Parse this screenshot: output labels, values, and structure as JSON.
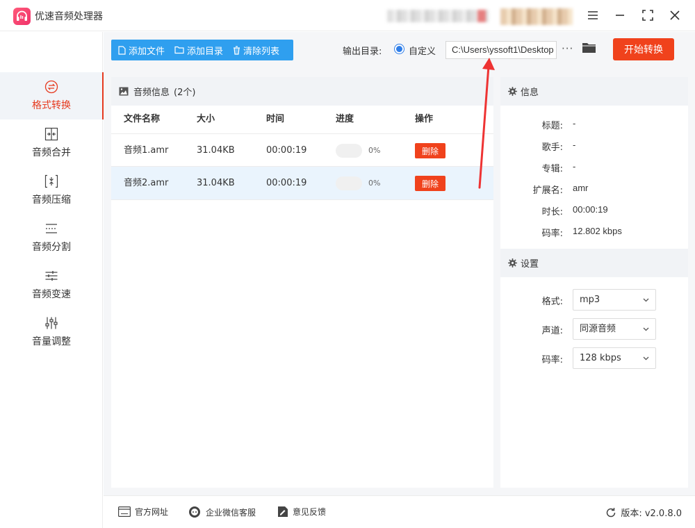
{
  "app": {
    "title": "优速音频处理器"
  },
  "sidebar": {
    "items": [
      {
        "label": "格式转换",
        "icon": "swap-icon",
        "active": true
      },
      {
        "label": "音频合并",
        "icon": "merge-icon"
      },
      {
        "label": "音频压缩",
        "icon": "compress-icon"
      },
      {
        "label": "音频分割",
        "icon": "split-icon"
      },
      {
        "label": "音频变速",
        "icon": "speed-icon"
      },
      {
        "label": "音量调整",
        "icon": "volume-icon"
      }
    ]
  },
  "toolbar": {
    "add_file": "添加文件",
    "add_dir": "添加目录",
    "clear_list": "清除列表"
  },
  "output": {
    "label": "输出目录:",
    "option": "自定义",
    "path": "C:\\Users\\yssoft1\\Desktop",
    "more": "···"
  },
  "start_button": "开始转换",
  "file_panel": {
    "title": "音频信息",
    "count": "(2个)",
    "columns": [
      "文件名称",
      "大小",
      "时间",
      "进度",
      "操作"
    ],
    "rows": [
      {
        "name": "音频1.amr",
        "size": "31.04KB",
        "time": "00:00:19",
        "progress": 0,
        "progress_text": "0%",
        "action": "删除"
      },
      {
        "name": "音频2.amr",
        "size": "31.04KB",
        "time": "00:00:19",
        "progress": 0,
        "progress_text": "0%",
        "action": "删除"
      }
    ]
  },
  "info_panel": {
    "title": "信息",
    "fields": [
      {
        "key": "标题:",
        "value": "-"
      },
      {
        "key": "歌手:",
        "value": "-"
      },
      {
        "key": "专辑:",
        "value": "-"
      },
      {
        "key": "扩展名:",
        "value": "amr"
      },
      {
        "key": "时长:",
        "value": "00:00:19"
      },
      {
        "key": "码率:",
        "value": "12.802 kbps"
      }
    ]
  },
  "settings_panel": {
    "title": "设置",
    "fields": [
      {
        "key": "格式:",
        "value": "mp3"
      },
      {
        "key": "声道:",
        "value": "同源音频"
      },
      {
        "key": "码率:",
        "value": "128 kbps"
      }
    ]
  },
  "footer": {
    "website": "官方网址",
    "wechat": "企业微信客服",
    "feedback": "意见反馈",
    "version": "版本: v2.0.8.0"
  },
  "colors": {
    "accent": "#e63a1f",
    "primary_blue": "#2f9fef",
    "start_button": "#f0421c"
  }
}
